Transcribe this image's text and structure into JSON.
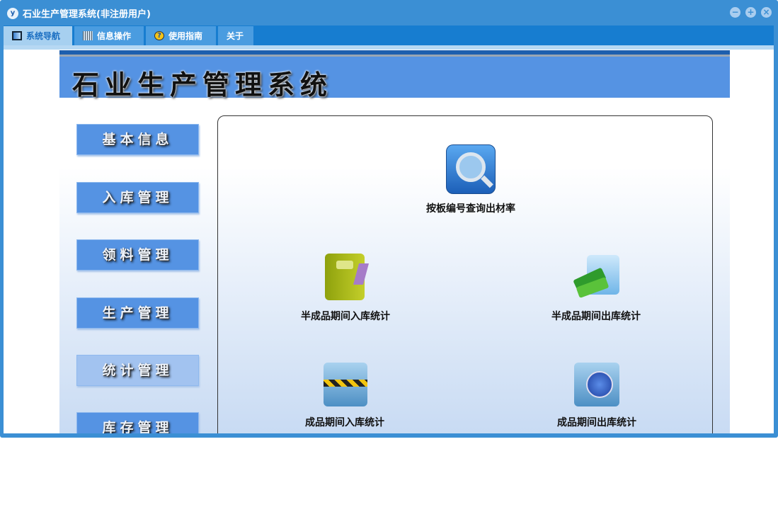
{
  "window": {
    "title": "石业生产管理系统(非注册用户)",
    "logo_text": "y"
  },
  "tabs": [
    {
      "label": "系统导航",
      "icon": "monitor-icon"
    },
    {
      "label": "信息操作",
      "icon": "grid-icon"
    },
    {
      "label": "使用指南",
      "icon": "help-icon"
    },
    {
      "label": "关于"
    }
  ],
  "banner": {
    "title": "石业生产管理系统"
  },
  "nav": [
    "基本信息",
    "入库管理",
    "领料管理",
    "生产管理",
    "统计管理",
    "库存管理"
  ],
  "selected_nav": "统计管理",
  "items": [
    {
      "label": "按板编号查询出材率",
      "icon": "magnifier-icon"
    },
    {
      "label": "半成品期间入库统计",
      "icon": "notebook-icon"
    },
    {
      "label": "半成品期间出库统计",
      "icon": "books-folder-icon"
    },
    {
      "label": "成品期间入库统计",
      "icon": "caution-folder-icon"
    },
    {
      "label": "成品期间出库统计",
      "icon": "globe-folder-icon"
    }
  ],
  "colors": {
    "frame": "#3b8fd4",
    "tabbar": "#177dd0",
    "banner": "#5593e3"
  }
}
